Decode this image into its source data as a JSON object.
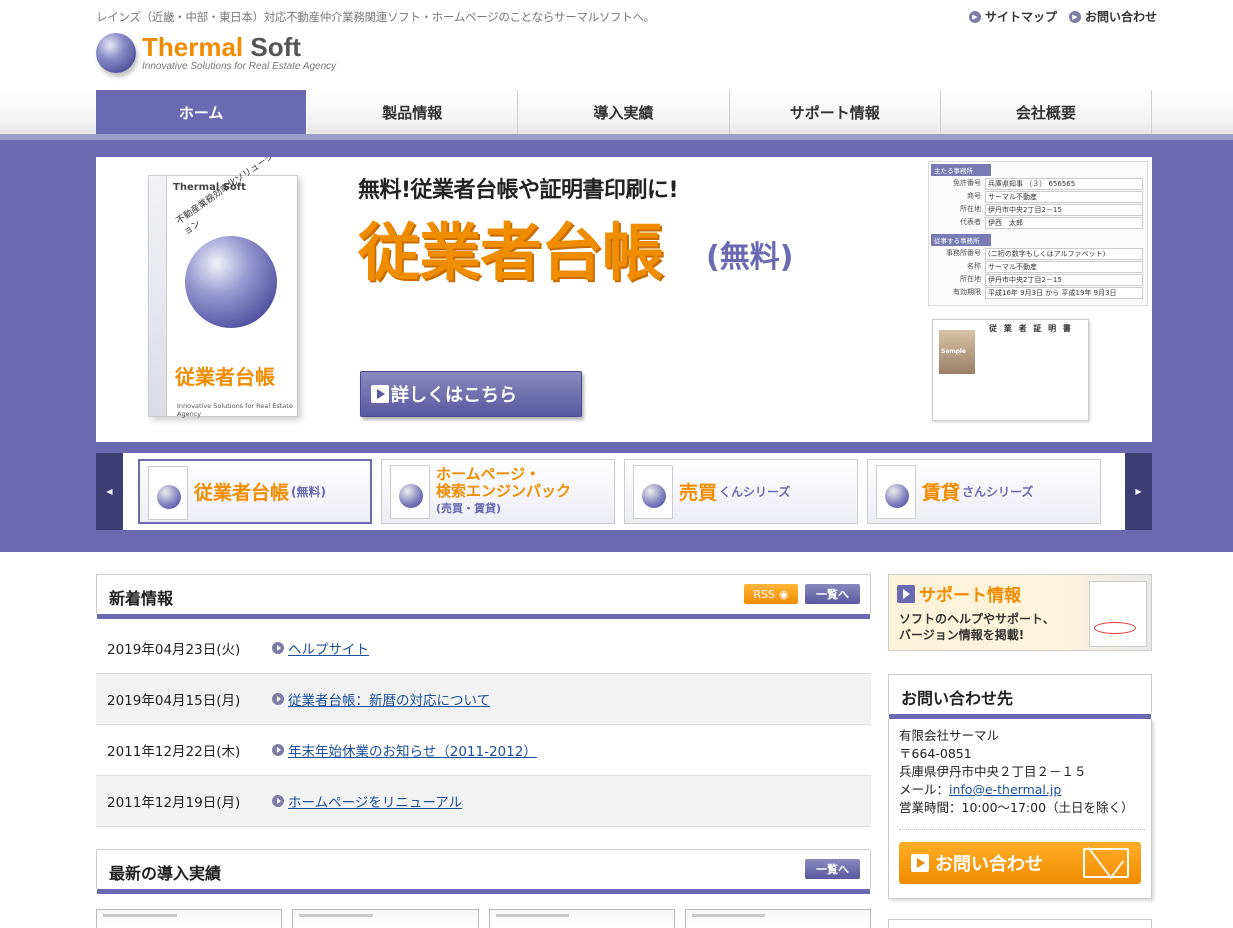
{
  "header": {
    "tagline": "レインズ（近畿・中部・東日本）対応不動産仲介業務関連ソフト・ホームページのことならサーマルソフトへ。",
    "links": [
      "サイトマップ",
      "お問い合わせ"
    ],
    "logo_main_1": "Thermal",
    "logo_main_2": " Soft",
    "logo_sub": "Innovative Solutions for Real Estate Agency"
  },
  "nav": {
    "items": [
      "ホーム",
      "製品情報",
      "導入実績",
      "サポート情報",
      "会社概要"
    ],
    "active": 0
  },
  "hero": {
    "box_brand": "Thermal Soft",
    "box_vertical": "不動産業務効率化ソリューション",
    "box_title": "従業者台帳",
    "box_sub": "Innovative Solutions for Real Estate Agency",
    "kicker": "無料!従業者台帳や証明書印刷に!",
    "title": "従業者台帳",
    "title_suffix": "(無料)",
    "button_label": "詳しくはこちら",
    "form": {
      "head1": "主たる事務所",
      "rows1": [
        [
          "免許番号",
          "兵庫県知事 （３） 656565"
        ],
        [
          "商号",
          "サーマル不動産"
        ],
        [
          "所在地",
          "伊丹市中央2丁目2－15"
        ],
        [
          "代表者",
          "伊西　太郎"
        ]
      ],
      "head2": "従事する事務所",
      "rows2": [
        [
          "事務所番号",
          "(二桁の数字もしくはアルファベット)"
        ],
        [
          "名称",
          "サーマル不動産"
        ],
        [
          "所在地",
          "伊丹市中央2丁目2－15"
        ],
        [
          "有効期限",
          "平成16年 9月3日 から 平成19年 9月3日"
        ]
      ]
    },
    "cert": {
      "title": "従 業 者 証 明 書",
      "photo_label": "Sample"
    }
  },
  "carousel": {
    "prev": "◀",
    "next": "▶",
    "thumbs": [
      {
        "main": "従業者台帳",
        "suffix": "(無料)"
      },
      {
        "main": "ホームページ・",
        "main2": "検索エンジンパック",
        "suffix": "(売買・賃貸)"
      },
      {
        "main": "売買",
        "suffix": "くんシリーズ"
      },
      {
        "main": "賃貸",
        "suffix": "さんシリーズ"
      }
    ]
  },
  "news": {
    "title": "新着情報",
    "rss_label": "RSS",
    "list_label": "一覧へ",
    "items": [
      {
        "date": "2019年04月23日(火)",
        "text": "ヘルプサイト"
      },
      {
        "date": "2019年04月15日(月)",
        "text": "従業者台帳：新暦の対応について"
      },
      {
        "date": "2011年12月22日(木)",
        "text": "年末年始休業のお知らせ（2011-2012）"
      },
      {
        "date": "2011年12月19日(月)",
        "text": "ホームページをリニューアル"
      }
    ]
  },
  "works": {
    "title": "最新の導入実績",
    "list_label": "一覧へ"
  },
  "sidebar": {
    "support_title": "サポート情報",
    "support_line1": "ソフトのヘルプやサポート、",
    "support_line2": "バージョン情報を掲載!",
    "contact_title": "お問い合わせ先",
    "company": "有限会社サーマル",
    "zip": "〒664-0851",
    "address": "兵庫県伊丹市中央２丁目２－１５",
    "mail_label": "メール：",
    "mail": "info@e-thermal.jp",
    "hours": "営業時間：10:00～17:00（土日を除く）",
    "contact_button": "お問い合わせ"
  }
}
